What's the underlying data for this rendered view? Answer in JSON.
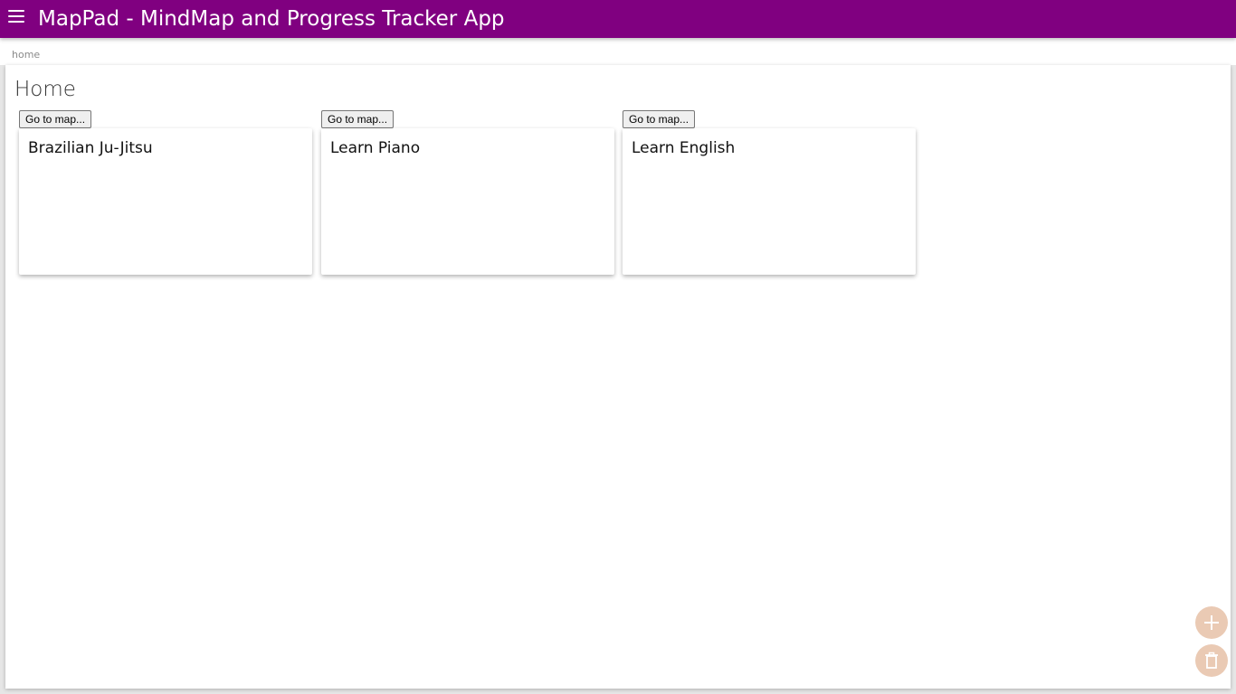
{
  "header": {
    "title": "MapPad - MindMap and Progress Tracker App",
    "menu_icon": "hamburger-menu-icon",
    "background_color": "#800080"
  },
  "breadcrumb": {
    "text": "home"
  },
  "main": {
    "title": "Home",
    "maps": [
      {
        "button_label": "Go to map...",
        "name": "Brazilian Ju-Jitsu"
      },
      {
        "button_label": "Go to map...",
        "name": "Learn Piano"
      },
      {
        "button_label": "Go to map...",
        "name": "Learn English"
      }
    ]
  },
  "fabs": {
    "add_icon": "plus-icon",
    "delete_icon": "trash-icon",
    "color": "#eacab4"
  }
}
